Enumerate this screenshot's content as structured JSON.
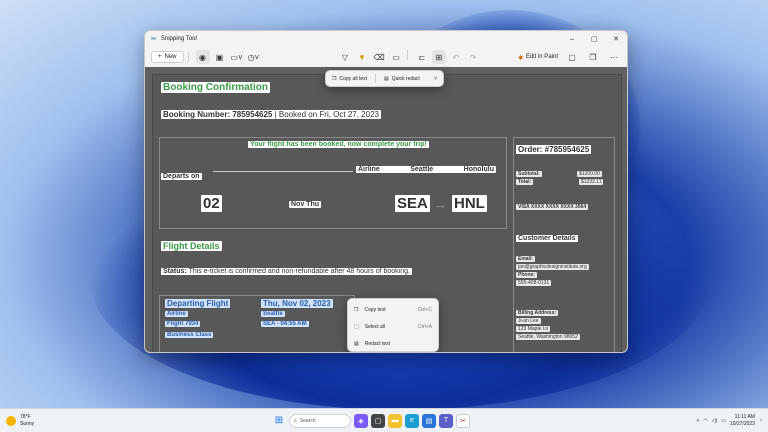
{
  "window": {
    "title": "Snipping Tool",
    "controls": [
      "–",
      "▢",
      "✕"
    ]
  },
  "toolbar": {
    "new_label": "New",
    "new_icon": "+",
    "edit_in_paint": "Edit in Paint"
  },
  "text_actions": {
    "copy_all": "Copy all text",
    "quick_redact": "Quick redact"
  },
  "doc": {
    "title": "Booking Confirmation",
    "booking_number": "Booking Number: 785954625",
    "booked_on": "| Booked on Fri, Oct 27, 2023",
    "banner": "Your flight has been booked, now complete your trip!",
    "departs_on": "Departs on",
    "airline_header": "Airline",
    "from_header": "Seattle",
    "to_header": "Honolulu",
    "day": "02",
    "month_day": "Nov Thu",
    "from_code": "SEA",
    "arrow": "→",
    "to_code": "HNL",
    "flight_details": "Flight Details",
    "status": "Status:",
    "status_text": "This e-ticket is confirmed and non-refundable after 48 hours of booking.",
    "departing_flight": "Departing Flight",
    "airline": "Airline",
    "flight_no": "Flight 7934",
    "class": "Business Class",
    "dep_date": "Thu, Nov 02, 2023",
    "dep_city": "Seattle",
    "dep_time": "SEA - 04:55 AM",
    "order": "Order: #785954625",
    "subtotal_label": "Subtotal:",
    "subtotal_value": "$1200.00",
    "total_label": "Total:",
    "total_value": "$1332.11",
    "visa": "VISA XXXX XXXX XXXX 3564",
    "customer_details": "Customer Details",
    "email_label": "Email:",
    "email": "jan@graphicdesigninstitute.org",
    "phone_label": "Phone:",
    "phone": "555-408-0131",
    "billing_label": "Billing Address:",
    "billing_name": "Ji-an Lee",
    "billing_street": "123 Maple Ln",
    "billing_city": "Seattle, Washington 98052"
  },
  "context_menu": [
    {
      "label": "Copy text",
      "shortcut": "Ctrl+C",
      "icon": "copy-icon"
    },
    {
      "label": "Select all",
      "shortcut": "Ctrl+A",
      "icon": "select-all-icon"
    },
    {
      "label": "Redact text",
      "shortcut": "",
      "icon": "redact-icon"
    }
  ],
  "taskbar": {
    "temp": "78°F",
    "weather": "Sunny",
    "search_placeholder": "Search",
    "time": "11:11 AM",
    "date": "10/27/2023"
  }
}
